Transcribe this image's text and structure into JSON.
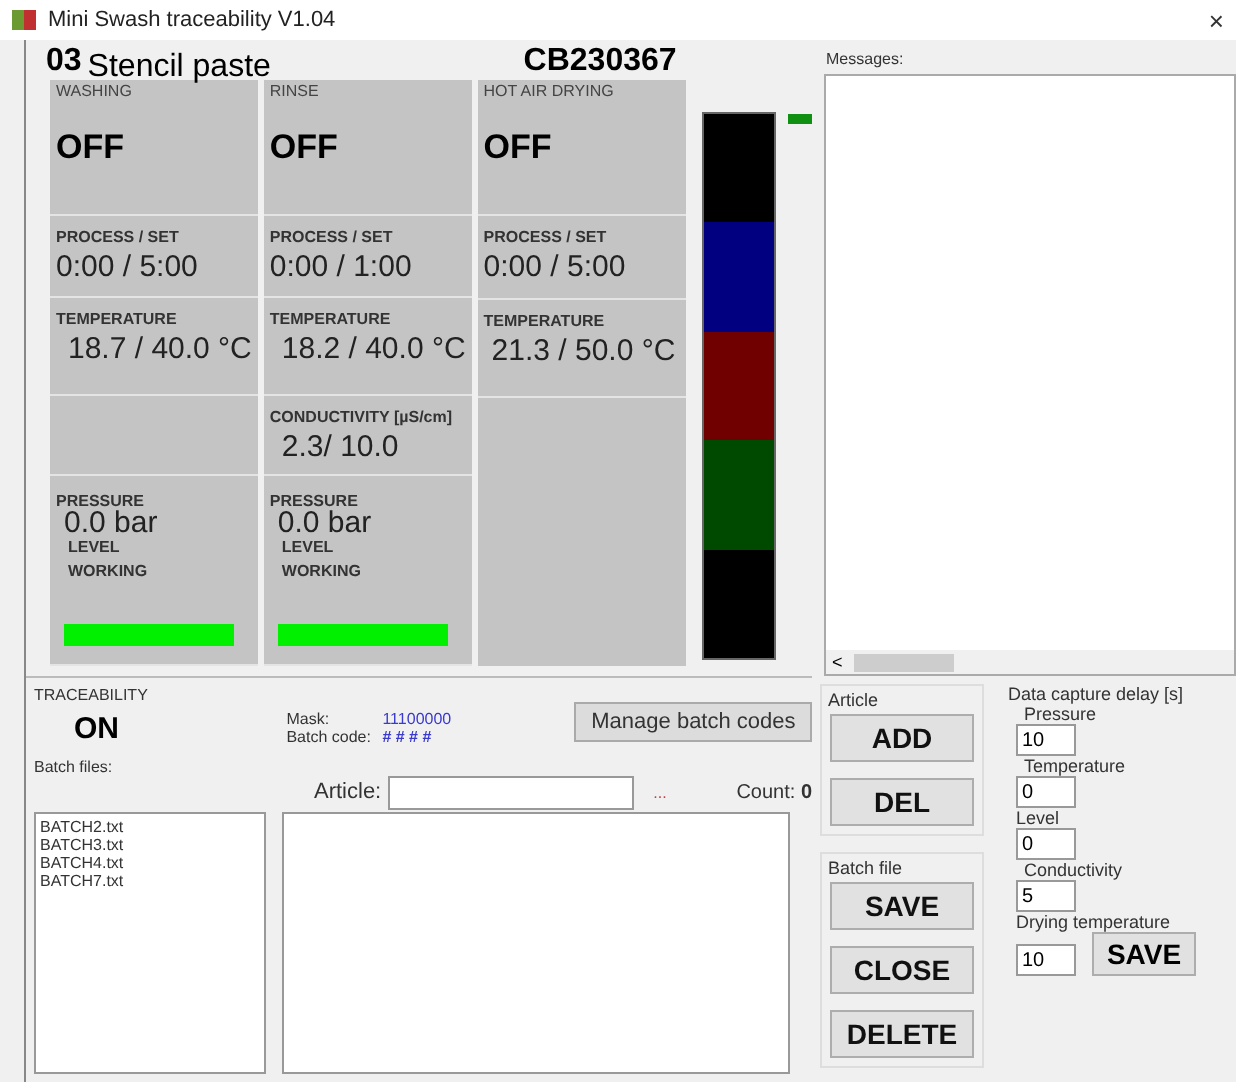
{
  "window": {
    "title": "Mini Swash traceability V1.04",
    "close": "×"
  },
  "header": {
    "number": "03",
    "program": "Stencil paste",
    "code": "CB230367"
  },
  "stations": [
    {
      "title": "WASHING",
      "state": "OFF",
      "process_label": "PROCESS / SET",
      "process": "0:00 / 5:00",
      "temperature_label": "TEMPERATURE",
      "temperature": "18.7 / 40.0 °C",
      "pressure_label": "PRESSURE",
      "pressure": "0.0 bar",
      "level_label": "LEVEL",
      "working_label": "WORKING",
      "working": true
    },
    {
      "title": "RINSE",
      "state": "OFF",
      "process_label": "PROCESS / SET",
      "process": "0:00 / 1:00",
      "temperature_label": "TEMPERATURE",
      "temperature": "18.2 / 40.0 °C",
      "conductivity_label": "CONDUCTIVITY [µS/cm]",
      "conductivity": "2.3/ 10.0",
      "pressure_label": "PRESSURE",
      "pressure": "0.0 bar",
      "level_label": "LEVEL",
      "working_label": "WORKING",
      "working": true
    },
    {
      "title": "HOT AIR DRYING",
      "state": "OFF",
      "process_label": "PROCESS / SET",
      "process": "0:00 / 5:00",
      "temperature_label": "TEMPERATURE",
      "temperature": "21.3 / 50.0 °C"
    }
  ],
  "signal_lights": [
    {
      "color": "#000000"
    },
    {
      "color": "#000080"
    },
    {
      "color": "#700000"
    },
    {
      "color": "#004a00"
    },
    {
      "color": "#000000"
    }
  ],
  "status_light": {
    "color": "#109010"
  },
  "messages": {
    "label": "Messages:",
    "scroll_left": "<"
  },
  "traceability": {
    "title": "TRACEABILITY",
    "state": "ON",
    "mask_label": "Mask:",
    "mask": "11100000",
    "batch_code_label": "Batch code:",
    "batch_code": "# # # #",
    "manage_button": "Manage batch codes",
    "batch_files_label": "Batch files:",
    "article_label": "Article:",
    "browse": "...",
    "count_label": "Count:",
    "count": "0",
    "batch_files": [
      "BATCH2.txt",
      "BATCH3.txt",
      "BATCH4.txt",
      "BATCH7.txt"
    ]
  },
  "article": {
    "title": "Article",
    "buttons": [
      "ADD",
      "DEL"
    ]
  },
  "batch_file": {
    "title": "Batch file",
    "buttons": [
      "SAVE",
      "CLOSE",
      "DELETE"
    ]
  },
  "data_capture": {
    "title": "Data capture delay [s]",
    "fields": [
      {
        "label": "Pressure",
        "value": "10"
      },
      {
        "label": "Temperature",
        "value": "0"
      },
      {
        "label": "Level",
        "value": "0"
      },
      {
        "label": "Conductivity",
        "value": "5"
      },
      {
        "label": "Drying temperature",
        "value": "10"
      }
    ],
    "save": "SAVE"
  }
}
